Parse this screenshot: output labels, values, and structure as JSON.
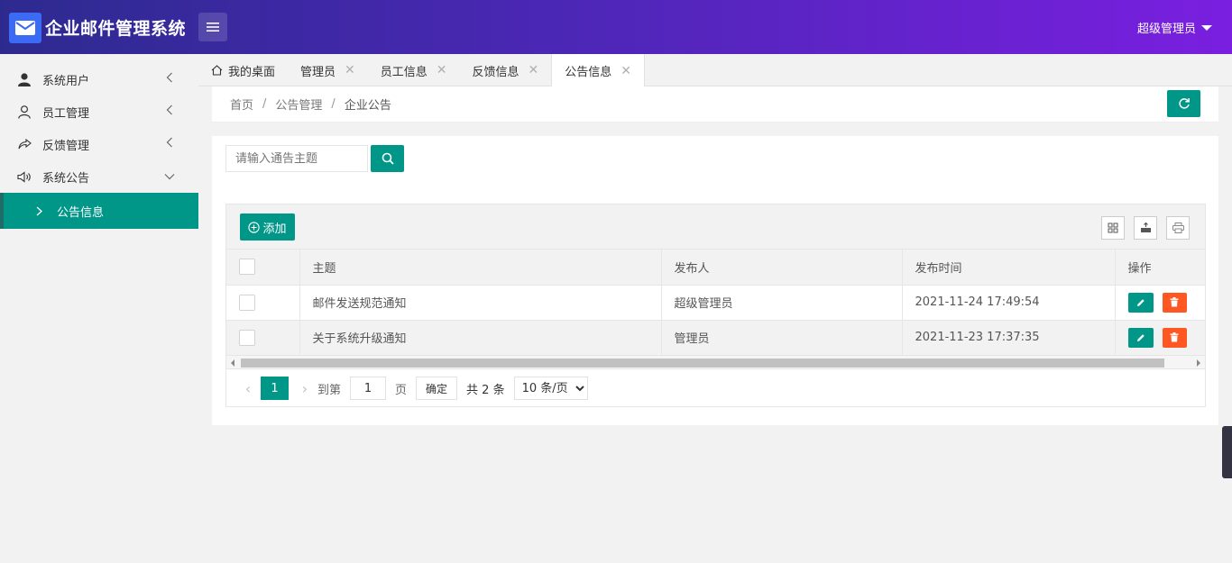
{
  "header": {
    "title": "企业邮件管理系统",
    "user": "超级管理员",
    "logo_icon": "mail-icon",
    "menu_icon": "hamburger-icon"
  },
  "sidebar": {
    "items": [
      {
        "label": "系统用户",
        "icon": "user-icon"
      },
      {
        "label": "员工管理",
        "icon": "user-outline-icon"
      },
      {
        "label": "反馈管理",
        "icon": "share-icon"
      },
      {
        "label": "系统公告",
        "icon": "speaker-icon"
      }
    ],
    "sub_item": "公告信息"
  },
  "tabs": [
    {
      "label": "我的桌面"
    },
    {
      "label": "管理员"
    },
    {
      "label": "员工信息"
    },
    {
      "label": "反馈信息"
    },
    {
      "label": "公告信息"
    }
  ],
  "breadcrumb": [
    "首页",
    "公告管理",
    "企业公告"
  ],
  "search": {
    "placeholder": "请输入通告主题"
  },
  "toolbar": {
    "add_label": "添加"
  },
  "table": {
    "headers": [
      "主题",
      "发布人",
      "发布时间",
      "操作"
    ],
    "rows": [
      {
        "subject": "邮件发送规范通知",
        "publisher": "超级管理员",
        "time": "2021-11-24 17:49:54"
      },
      {
        "subject": "关于系统升级通知",
        "publisher": "管理员",
        "time": "2021-11-23 17:37:35"
      }
    ]
  },
  "pager": {
    "current": "1",
    "goto_label": "到第",
    "page_input": "1",
    "page_label": "页",
    "ok_label": "确定",
    "total": "共 2 条",
    "page_size": "10 条/页"
  },
  "colors": {
    "primary": "#009688",
    "danger": "#ff5722",
    "header_start": "#2d2a8f",
    "header_end": "#7a1fe0"
  }
}
